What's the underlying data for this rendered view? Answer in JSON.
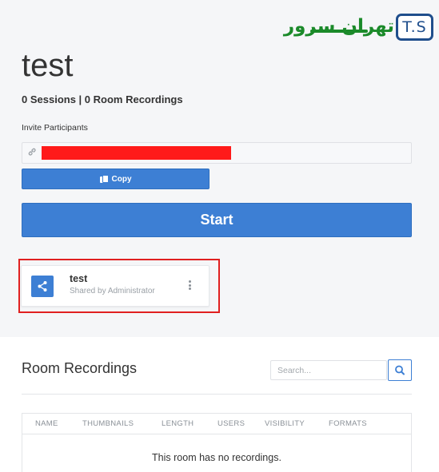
{
  "brand": {
    "logo_text_fa": "تهران سرور",
    "logo_box_text": "T.S"
  },
  "room": {
    "title": "test",
    "stats": "0 Sessions | 0 Room Recordings",
    "invite_label": "Invite Participants",
    "invite_value": "",
    "copy_label": "Copy",
    "start_label": "Start"
  },
  "room_card": {
    "title": "test",
    "subtitle": "Shared by Administrator"
  },
  "recordings": {
    "title": "Room Recordings",
    "search_placeholder": "Search...",
    "columns": [
      "NAME",
      "THUMBNAILS",
      "LENGTH",
      "USERS",
      "VISIBILITY",
      "FORMATS"
    ],
    "empty_message": "This room has no recordings."
  },
  "colors": {
    "primary": "#3d7fd4",
    "highlight_border": "#e02020",
    "redaction": "#ff1a1a",
    "logo_green": "#1b8a2a",
    "logo_blue": "#1f4e8c"
  },
  "icons": {
    "invite_field": "link-icon",
    "copy_button": "copy-icon",
    "room_card": "share-icon",
    "room_card_menu": "more-vertical-icon",
    "search_button": "search-icon"
  }
}
